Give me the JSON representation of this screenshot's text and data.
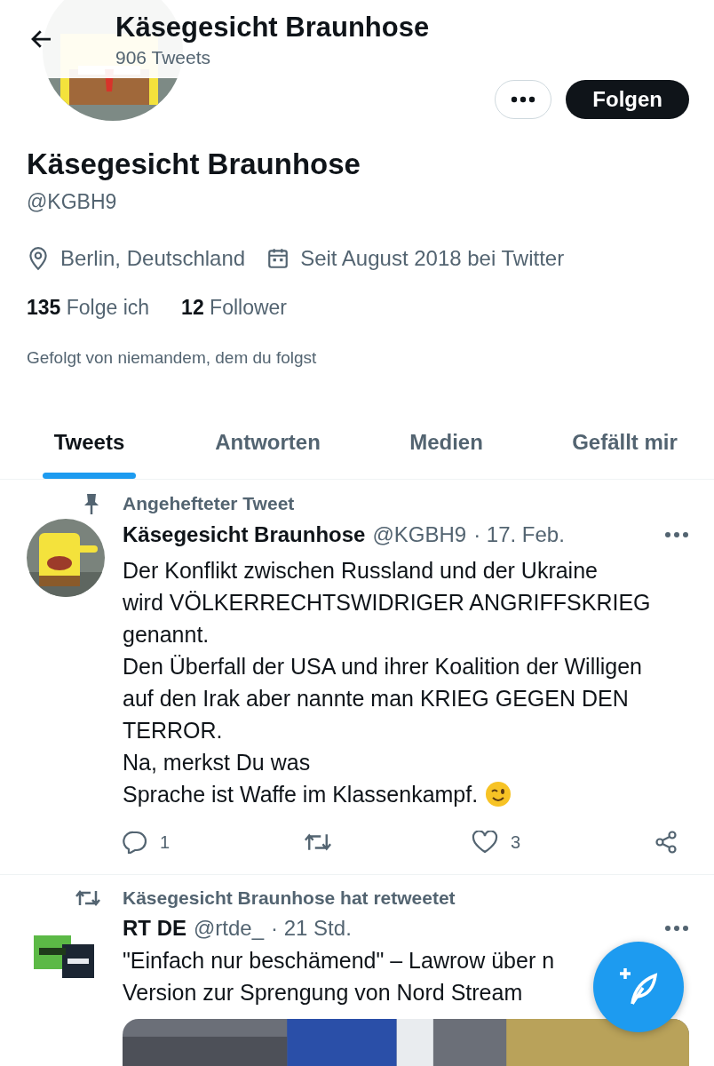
{
  "header": {
    "title": "Käsegesicht Braunhose",
    "subtitle": "906 Tweets"
  },
  "profile": {
    "follow_button": "Folgen",
    "name": "Käsegesicht Braunhose",
    "handle": "@KGBH9",
    "location": "Berlin, Deutschland",
    "joined": "Seit August 2018 bei Twitter",
    "stats": [
      {
        "count": "135",
        "label": "Folge ich"
      },
      {
        "count": "12",
        "label": "Follower"
      }
    ],
    "followed_by": "Gefolgt von niemandem, dem du folgst"
  },
  "tabs": [
    {
      "label": "Tweets",
      "selected": true
    },
    {
      "label": "Antworten",
      "selected": false
    },
    {
      "label": "Medien",
      "selected": false
    },
    {
      "label": "Gefällt mir",
      "selected": false
    }
  ],
  "tweets": [
    {
      "kind": "pinned",
      "context": "Angehefteter Tweet",
      "author": "Käsegesicht Braunhose",
      "handle": "@KGBH9",
      "time": "· 17. Feb.",
      "text": "Der Konflikt zwischen Russland und der Ukraine\nwird VÖLKERRECHTSWIDRIGER ANGRIFFSKRIEG\ngenannt.\nDen Überfall der USA und ihrer Koalition der Willigen\nauf den Irak aber nannte man KRIEG GEGEN DEN\nTERROR.\nNa, merkst Du was",
      "last_line": "Sprache ist Waffe im Klassenkampf.",
      "replies": "1",
      "likes": "3"
    },
    {
      "kind": "retweet",
      "context": "Käsegesicht Braunhose hat retweetet",
      "author": "RT DE",
      "handle": "@rtde_",
      "time": "· 21 Std.",
      "text_lines": [
        "\"Einfach nur beschämend\" – Lawrow über n",
        "Version zur Sprengung von Nord Stream"
      ]
    }
  ]
}
